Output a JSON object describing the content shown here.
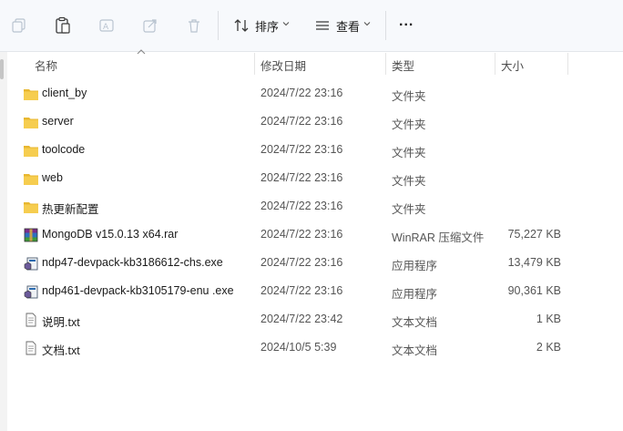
{
  "toolbar": {
    "sort_label": "排序",
    "view_label": "查看",
    "more_label": "..."
  },
  "columns": {
    "name": "名称",
    "modified": "修改日期",
    "type": "类型",
    "size": "大小"
  },
  "files": [
    {
      "name": "client_by",
      "modified": "2024/7/22 23:16",
      "type": "文件夹",
      "size": "",
      "icon": "folder-icon"
    },
    {
      "name": "server",
      "modified": "2024/7/22 23:16",
      "type": "文件夹",
      "size": "",
      "icon": "folder-icon"
    },
    {
      "name": "toolcode",
      "modified": "2024/7/22 23:16",
      "type": "文件夹",
      "size": "",
      "icon": "folder-icon"
    },
    {
      "name": "web",
      "modified": "2024/7/22 23:16",
      "type": "文件夹",
      "size": "",
      "icon": "folder-icon"
    },
    {
      "name": "热更新配置",
      "modified": "2024/7/22 23:16",
      "type": "文件夹",
      "size": "",
      "icon": "folder-icon"
    },
    {
      "name": "MongoDB v15.0.13 x64.rar",
      "modified": "2024/7/22 23:16",
      "type": "WinRAR 压缩文件",
      "size": "75,227 KB",
      "icon": "winrar-archive-icon"
    },
    {
      "name": "ndp47-devpack-kb3186612-chs.exe",
      "modified": "2024/7/22 23:16",
      "type": "应用程序",
      "size": "13,479 KB",
      "icon": "installer-exe-icon"
    },
    {
      "name": "ndp461-devpack-kb3105179-enu .exe",
      "modified": "2024/7/22 23:16",
      "type": "应用程序",
      "size": "90,361 KB",
      "icon": "installer-exe-icon"
    },
    {
      "name": "说明.txt",
      "modified": "2024/7/22 23:42",
      "type": "文本文档",
      "size": "1 KB",
      "icon": "text-document-icon"
    },
    {
      "name": "文档.txt",
      "modified": "2024/10/5 5:39",
      "type": "文本文档",
      "size": "2 KB",
      "icon": "text-document-icon"
    }
  ]
}
